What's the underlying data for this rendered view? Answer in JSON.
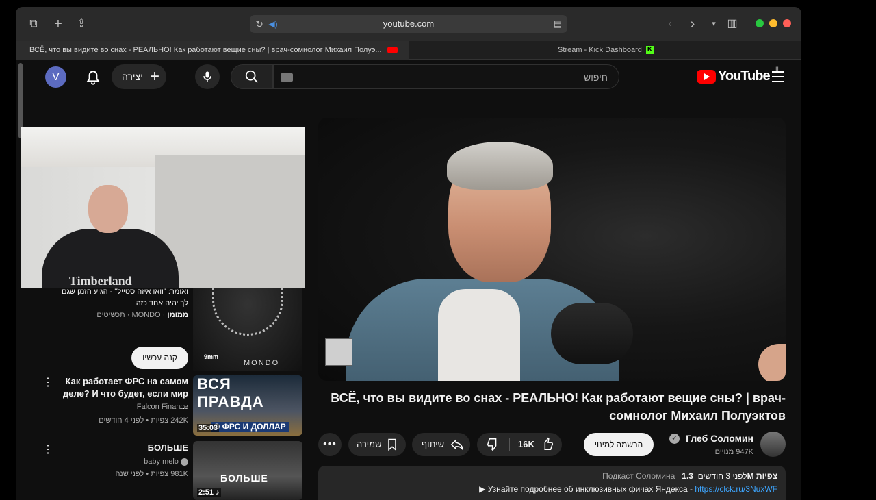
{
  "browser": {
    "url": "youtube.com",
    "tabs": [
      {
        "title": "ВСЁ, что вы видите во снах - РЕАЛЬНО! Как работают вещие сны? | врач-сомнолог Михаил Полуэ..."
      },
      {
        "title": "Stream - Kick Dashboard"
      }
    ],
    "colors": {
      "close": "#ff5f57",
      "minimize": "#febc2e",
      "zoom": "#28c840"
    }
  },
  "header": {
    "avatar_letter": "V",
    "create_label": "יצירה",
    "search_placeholder": "חיפוש",
    "logo_text": "YouTube",
    "logo_country": "IL"
  },
  "ad": {
    "text": "ואומר: \"וואו איזה סטייל\" - הגיע הזמן שגם לך יהיה אחד כזה",
    "sponsored": "ממומן",
    "brand": "MONDO · תכשיטים",
    "thumb_size": "9mm",
    "thumb_brand": "MONDO",
    "cta": "קנה עכשיו"
  },
  "related": [
    {
      "title": "Как работает ФРС на самом деле? И что будет, если мир …",
      "channel": "Falcon Finance",
      "meta": "242K צפיות • לפני 4 חודשים",
      "duration": "35:03",
      "thumb_title": "ВСЯ ПРАВДА",
      "thumb_sub": "О ФРС И ДОЛЛАР"
    },
    {
      "title": "БОЛЬШЕ",
      "channel": "baby melo",
      "meta": "981K צפיות • לפני שנה",
      "duration": "2:51 ♪",
      "thumb_title": "БОЛЬШЕ"
    }
  ],
  "watch": {
    "title": "ВСЁ, что вы видите во снах - РЕАЛЬНО! Как работают вещие сны? | врач-сомнолог Михаил Полуэктов",
    "likes": "16K",
    "share_label": "שיתוף",
    "save_label": "שמירה",
    "subscribe_label": "הרשמה למינוי",
    "channel": "Глеб Соломин",
    "subscribers": "947K מנויים",
    "views": "1.3M צפיות",
    "age": "לפני 3 חודשים",
    "tag": "Подкаст Соломина",
    "desc_text": "▶ Узнайте подробнее об инклюзивных фичах Яндекса - ",
    "desc_link": "https://clck.ru/3NuxWF"
  },
  "overlay": {
    "shirt_text": "Timberland"
  }
}
